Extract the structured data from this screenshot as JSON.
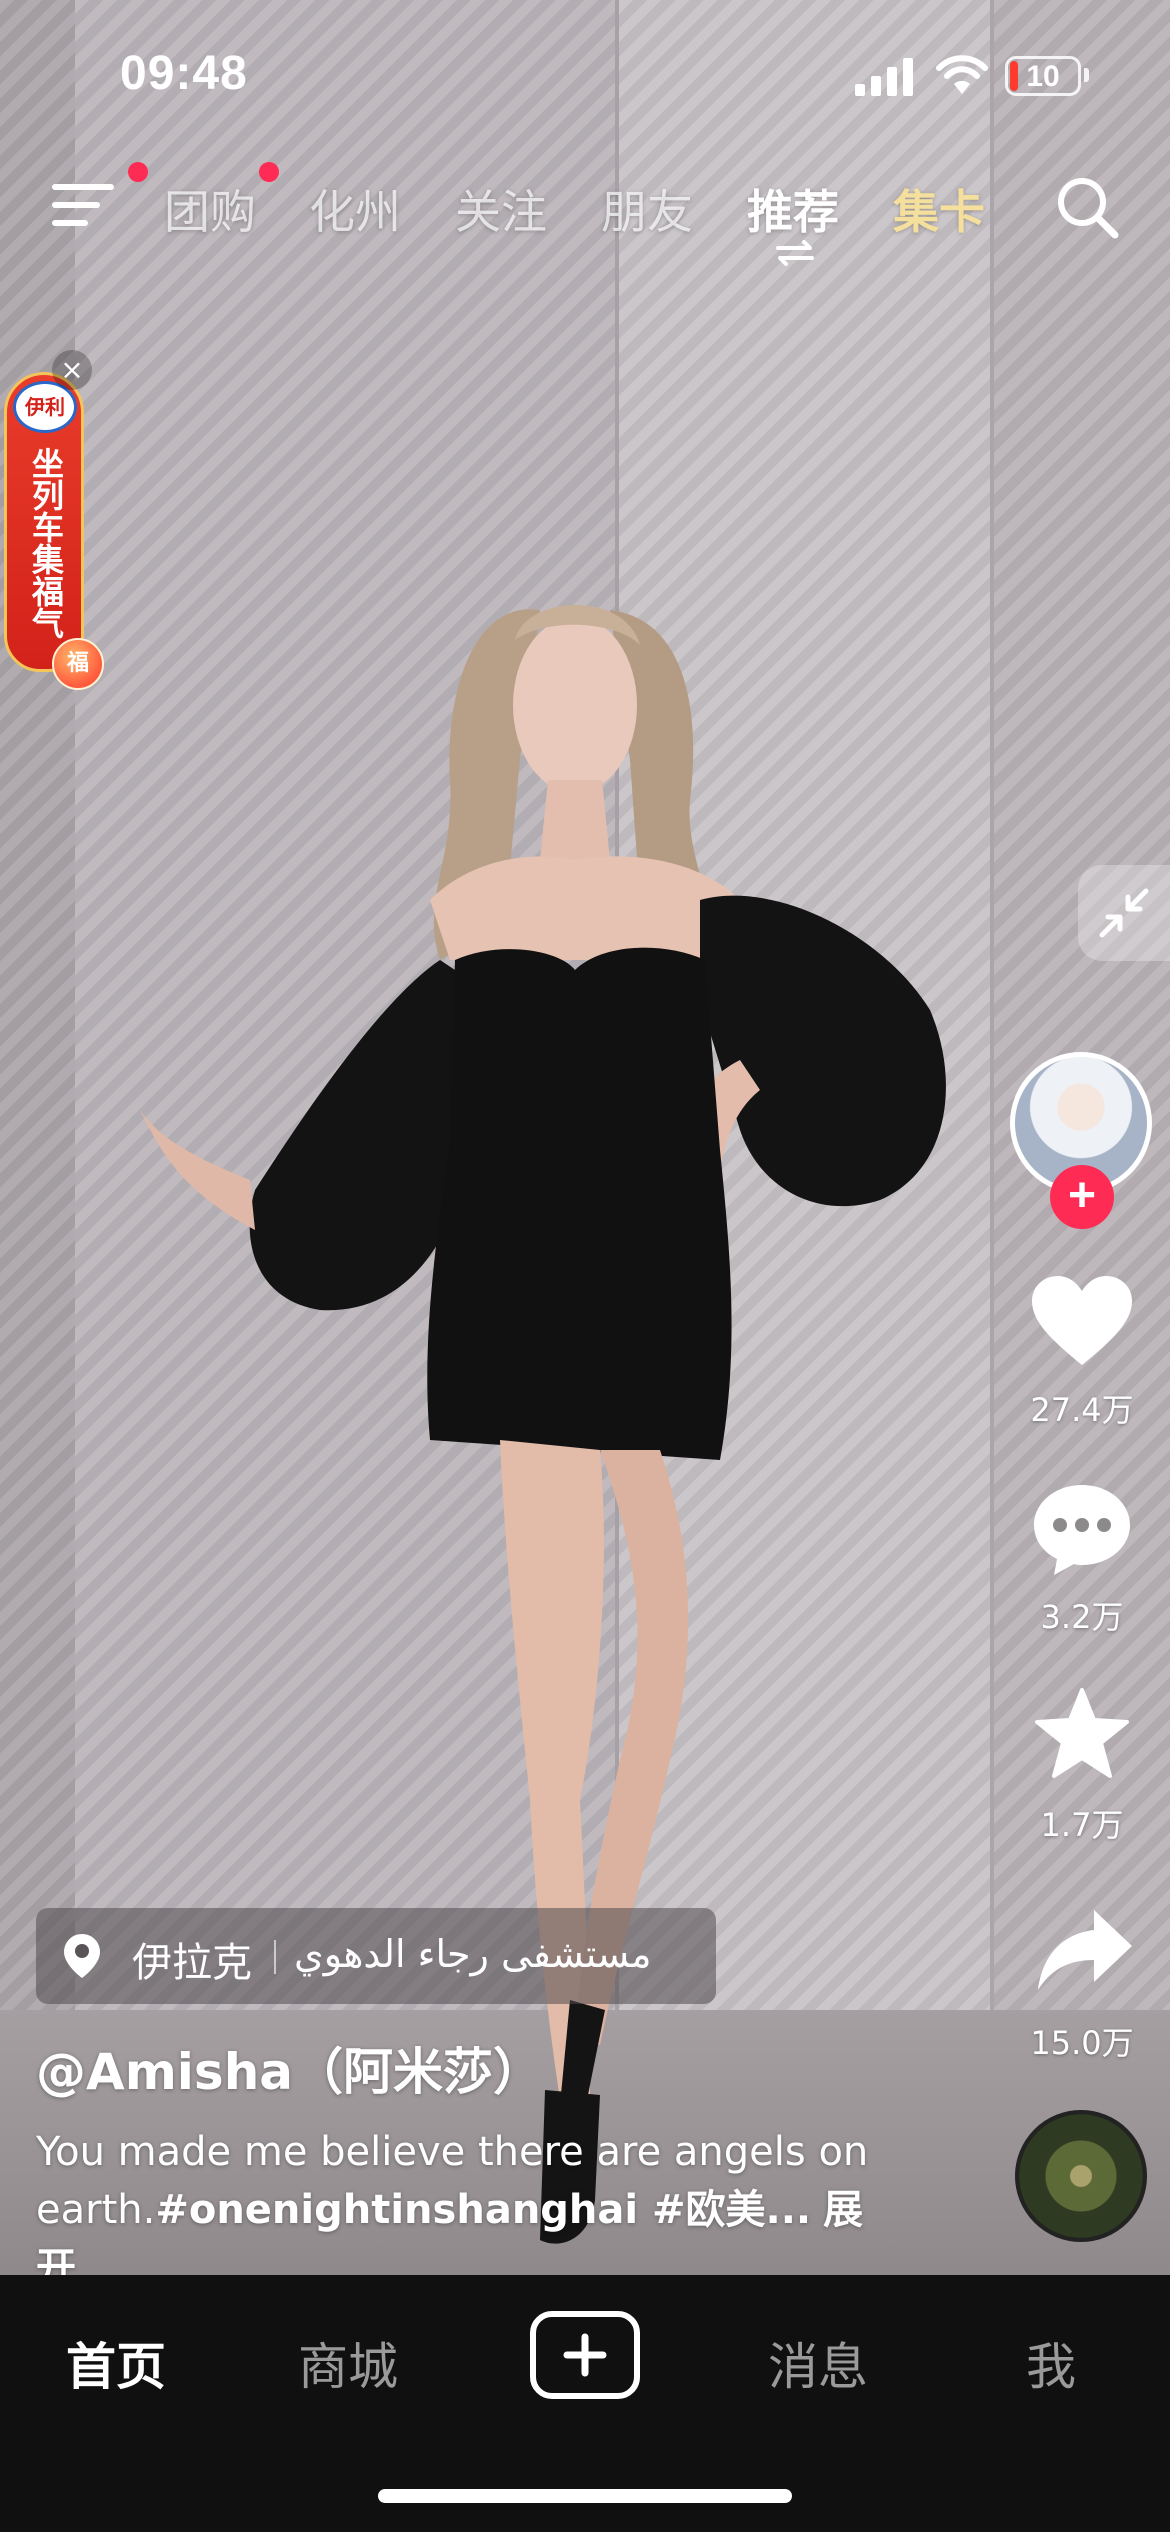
{
  "status_bar": {
    "time": "09:48",
    "battery_level": "10",
    "icons": [
      "signal-icon",
      "wifi-icon",
      "battery-icon"
    ]
  },
  "top_tabs": {
    "items": [
      {
        "label": "团购",
        "has_dot": true
      },
      {
        "label": "化州",
        "has_dot": false
      },
      {
        "label": "关注",
        "has_dot": false
      },
      {
        "label": "朋友",
        "has_dot": false
      },
      {
        "label": "推荐",
        "active": true
      },
      {
        "label": "集卡",
        "promo": true
      }
    ],
    "menu_has_dot": true
  },
  "promo_banner": {
    "logo_text": "伊利",
    "text": "坐列车集福气",
    "badge": "福"
  },
  "right_rail": {
    "likes": "27.4万",
    "comments": "3.2万",
    "favorites": "1.7万",
    "shares": "15.0万",
    "icons": [
      "collapse-icon",
      "heart-icon",
      "comment-icon",
      "star-icon",
      "share-icon"
    ]
  },
  "post": {
    "location_city": "伊拉克",
    "location_place": "مستشفى رجاء الدهوي",
    "author": "@Amisha（阿米莎）",
    "caption_text": "You made me believe there are angels on earth.",
    "caption_tags": "#onenightinshanghai #欧美...",
    "expand_label": "展开"
  },
  "bottom_nav": {
    "items": [
      "首页",
      "商城",
      "消息",
      "我"
    ],
    "active": "首页"
  },
  "colors": {
    "accent_red": "#fe2c55",
    "promo_gold": "#f5df9d",
    "nav_background": "#101010"
  }
}
